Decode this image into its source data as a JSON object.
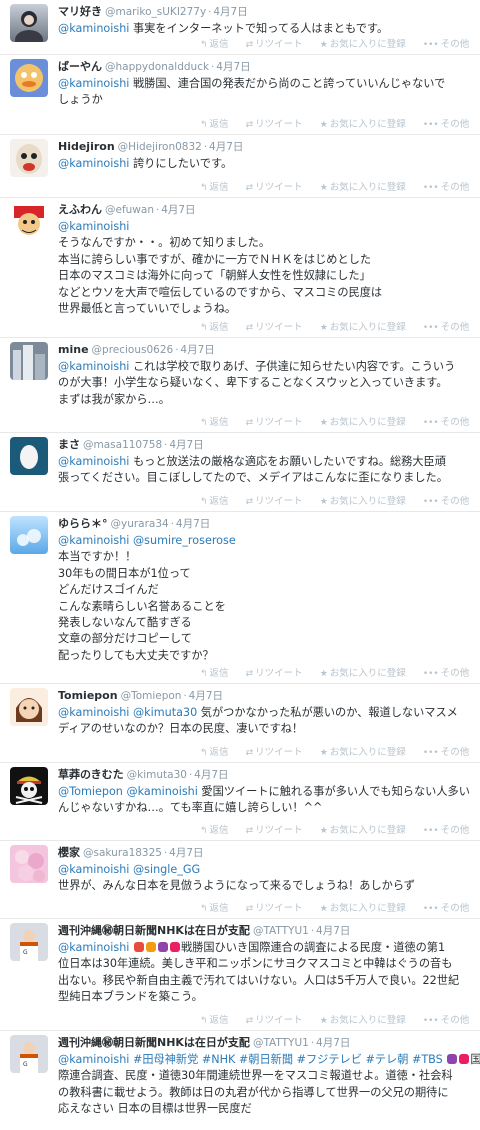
{
  "actions": {
    "reply": "返信",
    "retweet": "リツイート",
    "favorite": "お気に入りに登録",
    "more": "その他"
  },
  "tweets": [
    {
      "name": "マリ好き",
      "handle": "@mariko_sUKI277y",
      "time": "4月7日",
      "mentions": [
        "@kaminoishi"
      ],
      "lines": [
        "事実をインターネットで知ってる人はまともです。"
      ]
    },
    {
      "name": "ばーやん",
      "handle": "@happydonaldduck",
      "time": "4月7日",
      "mentions": [
        "@kaminoishi"
      ],
      "lines": [
        "戦勝国、連合国の発表だから尚のこと誇っていいんじゃないで",
        "しょうか"
      ]
    },
    {
      "name": "Hidejiron",
      "handle": "@Hidejiron0832",
      "time": "4月7日",
      "mentions": [
        "@kaminoishi"
      ],
      "lines": [
        "誇りにしたいです。"
      ]
    },
    {
      "name": "えふわん",
      "handle": "@efuwan",
      "time": "4月7日",
      "mentions": [
        "@kaminoishi"
      ],
      "lines": [
        "そうなんですか・・。初めて知りました。",
        "本当に誇らしい事ですが、確かに一方でＮＨＫをはじめとした",
        "日本のマスコミは海外に向って「朝鮮人女性を性奴隷にした」",
        "などとウソを大声で喧伝しているのですから、マスコミの民度は",
        "世界最低と言っていいでしょうね。"
      ]
    },
    {
      "name": "mine",
      "handle": "@precious0626",
      "time": "4月7日",
      "mentions": [
        "@kaminoishi"
      ],
      "lines": [
        "これは学校で取りあげ、子供達に知らせたい内容です。こういう",
        "のが大事！小学生なら疑いなく、卑下することなくスウッと入っていきます。",
        "まずは我が家から…。"
      ]
    },
    {
      "name": "まさ",
      "handle": "@masa110758",
      "time": "4月7日",
      "mentions": [
        "@kaminoishi"
      ],
      "lines": [
        "もっと放送法の厳格な適応をお願いしたいですね。総務大臣頑",
        "張ってください。目こぼししてたので、メデイアはこんなに歪になりました。"
      ]
    },
    {
      "name": "ゆらら＊°",
      "handle": "@yurara34",
      "time": "4月7日",
      "mentions": [
        "@kaminoishi",
        "@sumire_roserose"
      ],
      "lines": [
        "本当ですか！！",
        "30年もの間日本が1位って",
        "どんだけスゴイんだ",
        "こんな素晴らしい名誉あることを",
        "発表しないなんて酷すぎる",
        "文章の部分だけコピーして",
        "配ったりしても大丈夫ですか？"
      ]
    },
    {
      "name": "Tomiepon",
      "handle": "@Tomiepon",
      "time": "4月7日",
      "mentions": [
        "@kaminoishi",
        "@kimuta30"
      ],
      "lines": [
        "気がつかなかった私が悪いのか、報道しないマスメ",
        "ディアのせいなのか？日本の民度、凄いですね！"
      ]
    },
    {
      "name": "草莽のきむた",
      "handle": "@kimuta30",
      "time": "4月7日",
      "mentions": [
        "@Tomiepon",
        "@kaminoishi"
      ],
      "lines": [
        "愛国ツイートに触れる事が多い人でも知らない人多い",
        "んじゃないすかね…。ても率直に嬉し誇らしい！^^"
      ]
    },
    {
      "name": "櫻家",
      "handle": "@sakura18325",
      "time": "4月7日",
      "mentions": [
        "@kaminoishi",
        "@single_GG"
      ],
      "lines": [
        "世界が、みんな日本を見倣うようになって来るでしょうね！あしからず"
      ]
    },
    {
      "name": "週刊沖縄㊙朝日新聞NHKは在日が支配",
      "handle": "@TATTYU1",
      "time": "4月7日",
      "mentions": [
        "@kaminoishi"
      ],
      "lines": [
        "戦勝国ひいき国際連合の調査による民度・道徳の第1",
        "位日本は30年連続。美しき平和ニッポンにサヨクマスコミと中韓はぐうの音も",
        "出ない。移民や新自由主義で汚れてはいけない。人口は5千万人で良い。22世紀",
        "型純日本ブランドを築こう。"
      ]
    },
    {
      "name": "週刊沖縄㊙朝日新聞NHKは在日が支配",
      "handle": "@TATTYU1",
      "time": "4月7日",
      "mentions": [
        "@kaminoishi"
      ],
      "tags": [
        "#田母神新党",
        "#NHK",
        "#朝日新聞",
        "#フジテレビ",
        "#テレ朝",
        "#TBS"
      ],
      "lines": [
        "国",
        "際連合調査、民度・道徳30年間連続世界一をマスコミ報道せよ。道徳・社会科",
        "の教科書に載せよう。教師は日の丸君が代から指導して世界一の父兄の期待に",
        "応えなさい 日本の目標は世界一民度だ"
      ]
    }
  ]
}
